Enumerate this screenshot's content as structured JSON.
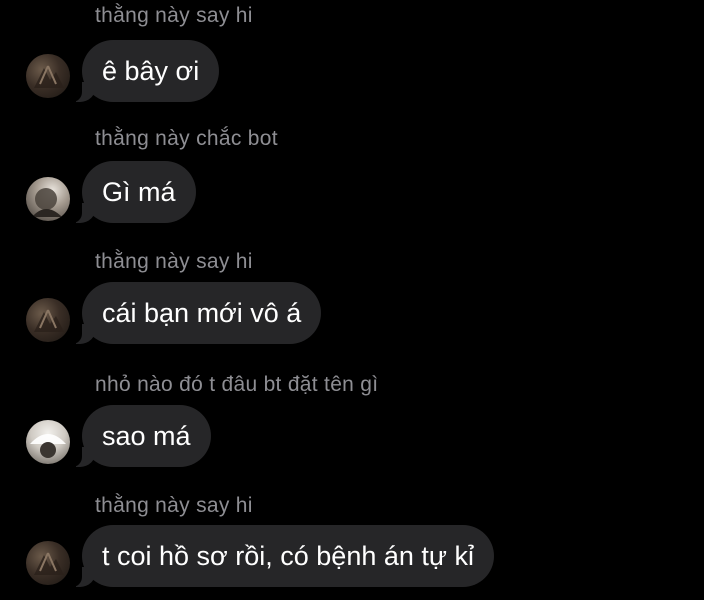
{
  "messages": [
    {
      "sender": "thằng này say hi",
      "text": "ê bây ơi",
      "avatar": "avatar-dark-photo"
    },
    {
      "sender": "thằng này chắc bot",
      "text": "Gì má",
      "avatar": "avatar-light-photo"
    },
    {
      "sender": "thằng này say hi",
      "text": "cái bạn mới vô á",
      "avatar": "avatar-dark-photo"
    },
    {
      "sender": "nhỏ nào đó t đâu bt đặt tên gì",
      "text": "sao má",
      "avatar": "avatar-white-photo"
    },
    {
      "sender": "thằng này say hi",
      "text": "t coi hồ sơ rồi, có bệnh án tự kỉ",
      "avatar": "avatar-dark-photo"
    }
  ],
  "colors": {
    "background": "#000000",
    "bubble": "#262628",
    "sender_text": "#8e8e93",
    "message_text": "#ffffff"
  }
}
